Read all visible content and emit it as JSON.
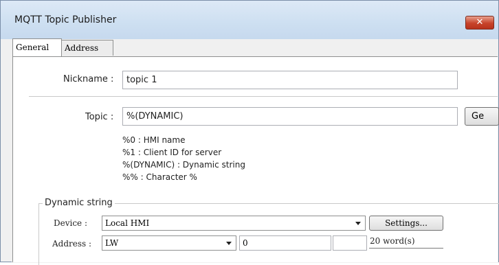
{
  "window": {
    "title": "MQTT Topic Publisher",
    "close_glyph": "✕"
  },
  "tabs": [
    {
      "label": "General"
    },
    {
      "label": "Address"
    }
  ],
  "nickname": {
    "label": "Nickname :",
    "value": "topic 1"
  },
  "topic": {
    "label": "Topic :",
    "value": "%(DYNAMIC)",
    "side_button": "Ge"
  },
  "hints": [
    "%0 : HMI name",
    "%1 : Client ID for server",
    "%(DYNAMIC) : Dynamic string",
    "%% : Character %"
  ],
  "dynamic_string": {
    "title": "Dynamic string",
    "device_label": "Device :",
    "device_value": "Local HMI",
    "settings_button": "Settings...",
    "address_label": "Address :",
    "address_type": "LW",
    "address_value": "0",
    "address_index": "",
    "length": "20 word(s)"
  }
}
